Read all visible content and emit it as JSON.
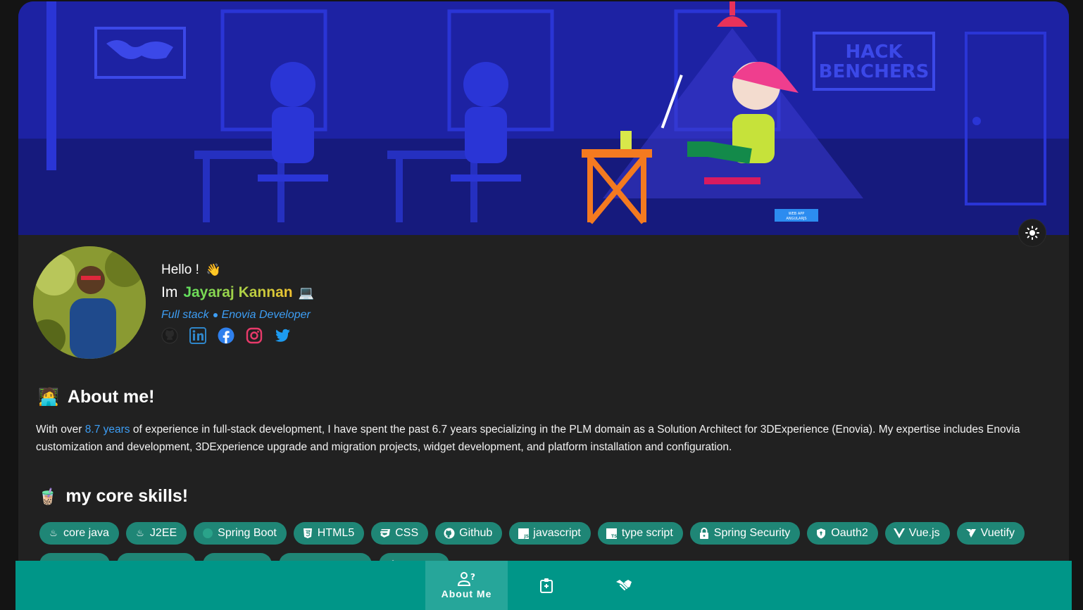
{
  "banner": {
    "sign_line1": "HACK",
    "sign_line2": "BENCHERS",
    "laptop_label1": "WEB APP",
    "laptop_label2": "ANGULARJS"
  },
  "theme_toggle": {
    "icon": "sun-icon"
  },
  "profile": {
    "hello": "Hello !",
    "hello_emoji": "👋",
    "im": "Im",
    "name": "Jayaraj Kannan",
    "name_emoji": "💻",
    "role_1": "Full stack",
    "role_2": "Enovia Developer",
    "socials": [
      "github-icon",
      "linkedin-icon",
      "facebook-icon",
      "instagram-icon",
      "twitter-icon"
    ]
  },
  "about": {
    "emoji": "🧑‍💻",
    "title": "About me!",
    "text_before": "With over ",
    "years": "8.7 years",
    "text_after": " of experience in full-stack development, I have spent the past 6.7 years specializing in the PLM domain as a Solution Architect for 3DExperience (Enovia). My expertise includes Enovia customization and development, 3DExperience upgrade and migration projects, widget development, and platform installation and configuration."
  },
  "skills": {
    "emoji": "🧋",
    "title": "my core skills!",
    "items": [
      {
        "label": "core java",
        "icon": "java-icon"
      },
      {
        "label": "J2EE",
        "icon": "java-icon"
      },
      {
        "label": "Spring Boot",
        "icon": "spring-icon"
      },
      {
        "label": "HTML5",
        "icon": "html5-icon"
      },
      {
        "label": "CSS",
        "icon": "css-icon"
      },
      {
        "label": "Github",
        "icon": "github-icon"
      },
      {
        "label": "javascript",
        "icon": "javascript-icon"
      },
      {
        "label": "type script",
        "icon": "typescript-icon"
      },
      {
        "label": "Spring Security",
        "icon": "lock-icon"
      },
      {
        "label": "Oauth2",
        "icon": "shield-icon"
      },
      {
        "label": "Vue.js",
        "icon": "vue-icon"
      },
      {
        "label": "Vuetify",
        "icon": "vuetify-icon"
      },
      {
        "label": "",
        "icon": "infinity-icon"
      },
      {
        "label": "",
        "icon": "api-icon"
      },
      {
        "label": "",
        "icon": "database-icon"
      },
      {
        "label": "",
        "icon": "database-icon"
      },
      {
        "label": "",
        "icon": "cube-icon"
      }
    ]
  },
  "bottom_nav": {
    "items": [
      {
        "label": "About Me",
        "icon": "account-question-icon",
        "active": true
      },
      {
        "label": "",
        "icon": "badge-account-icon",
        "active": false
      },
      {
        "label": "",
        "icon": "handshake-icon",
        "active": false
      }
    ]
  },
  "colors": {
    "accent": "#009688",
    "active_nav": "#26a69a",
    "link": "#3d9ef5",
    "chip": "#1f8676"
  }
}
